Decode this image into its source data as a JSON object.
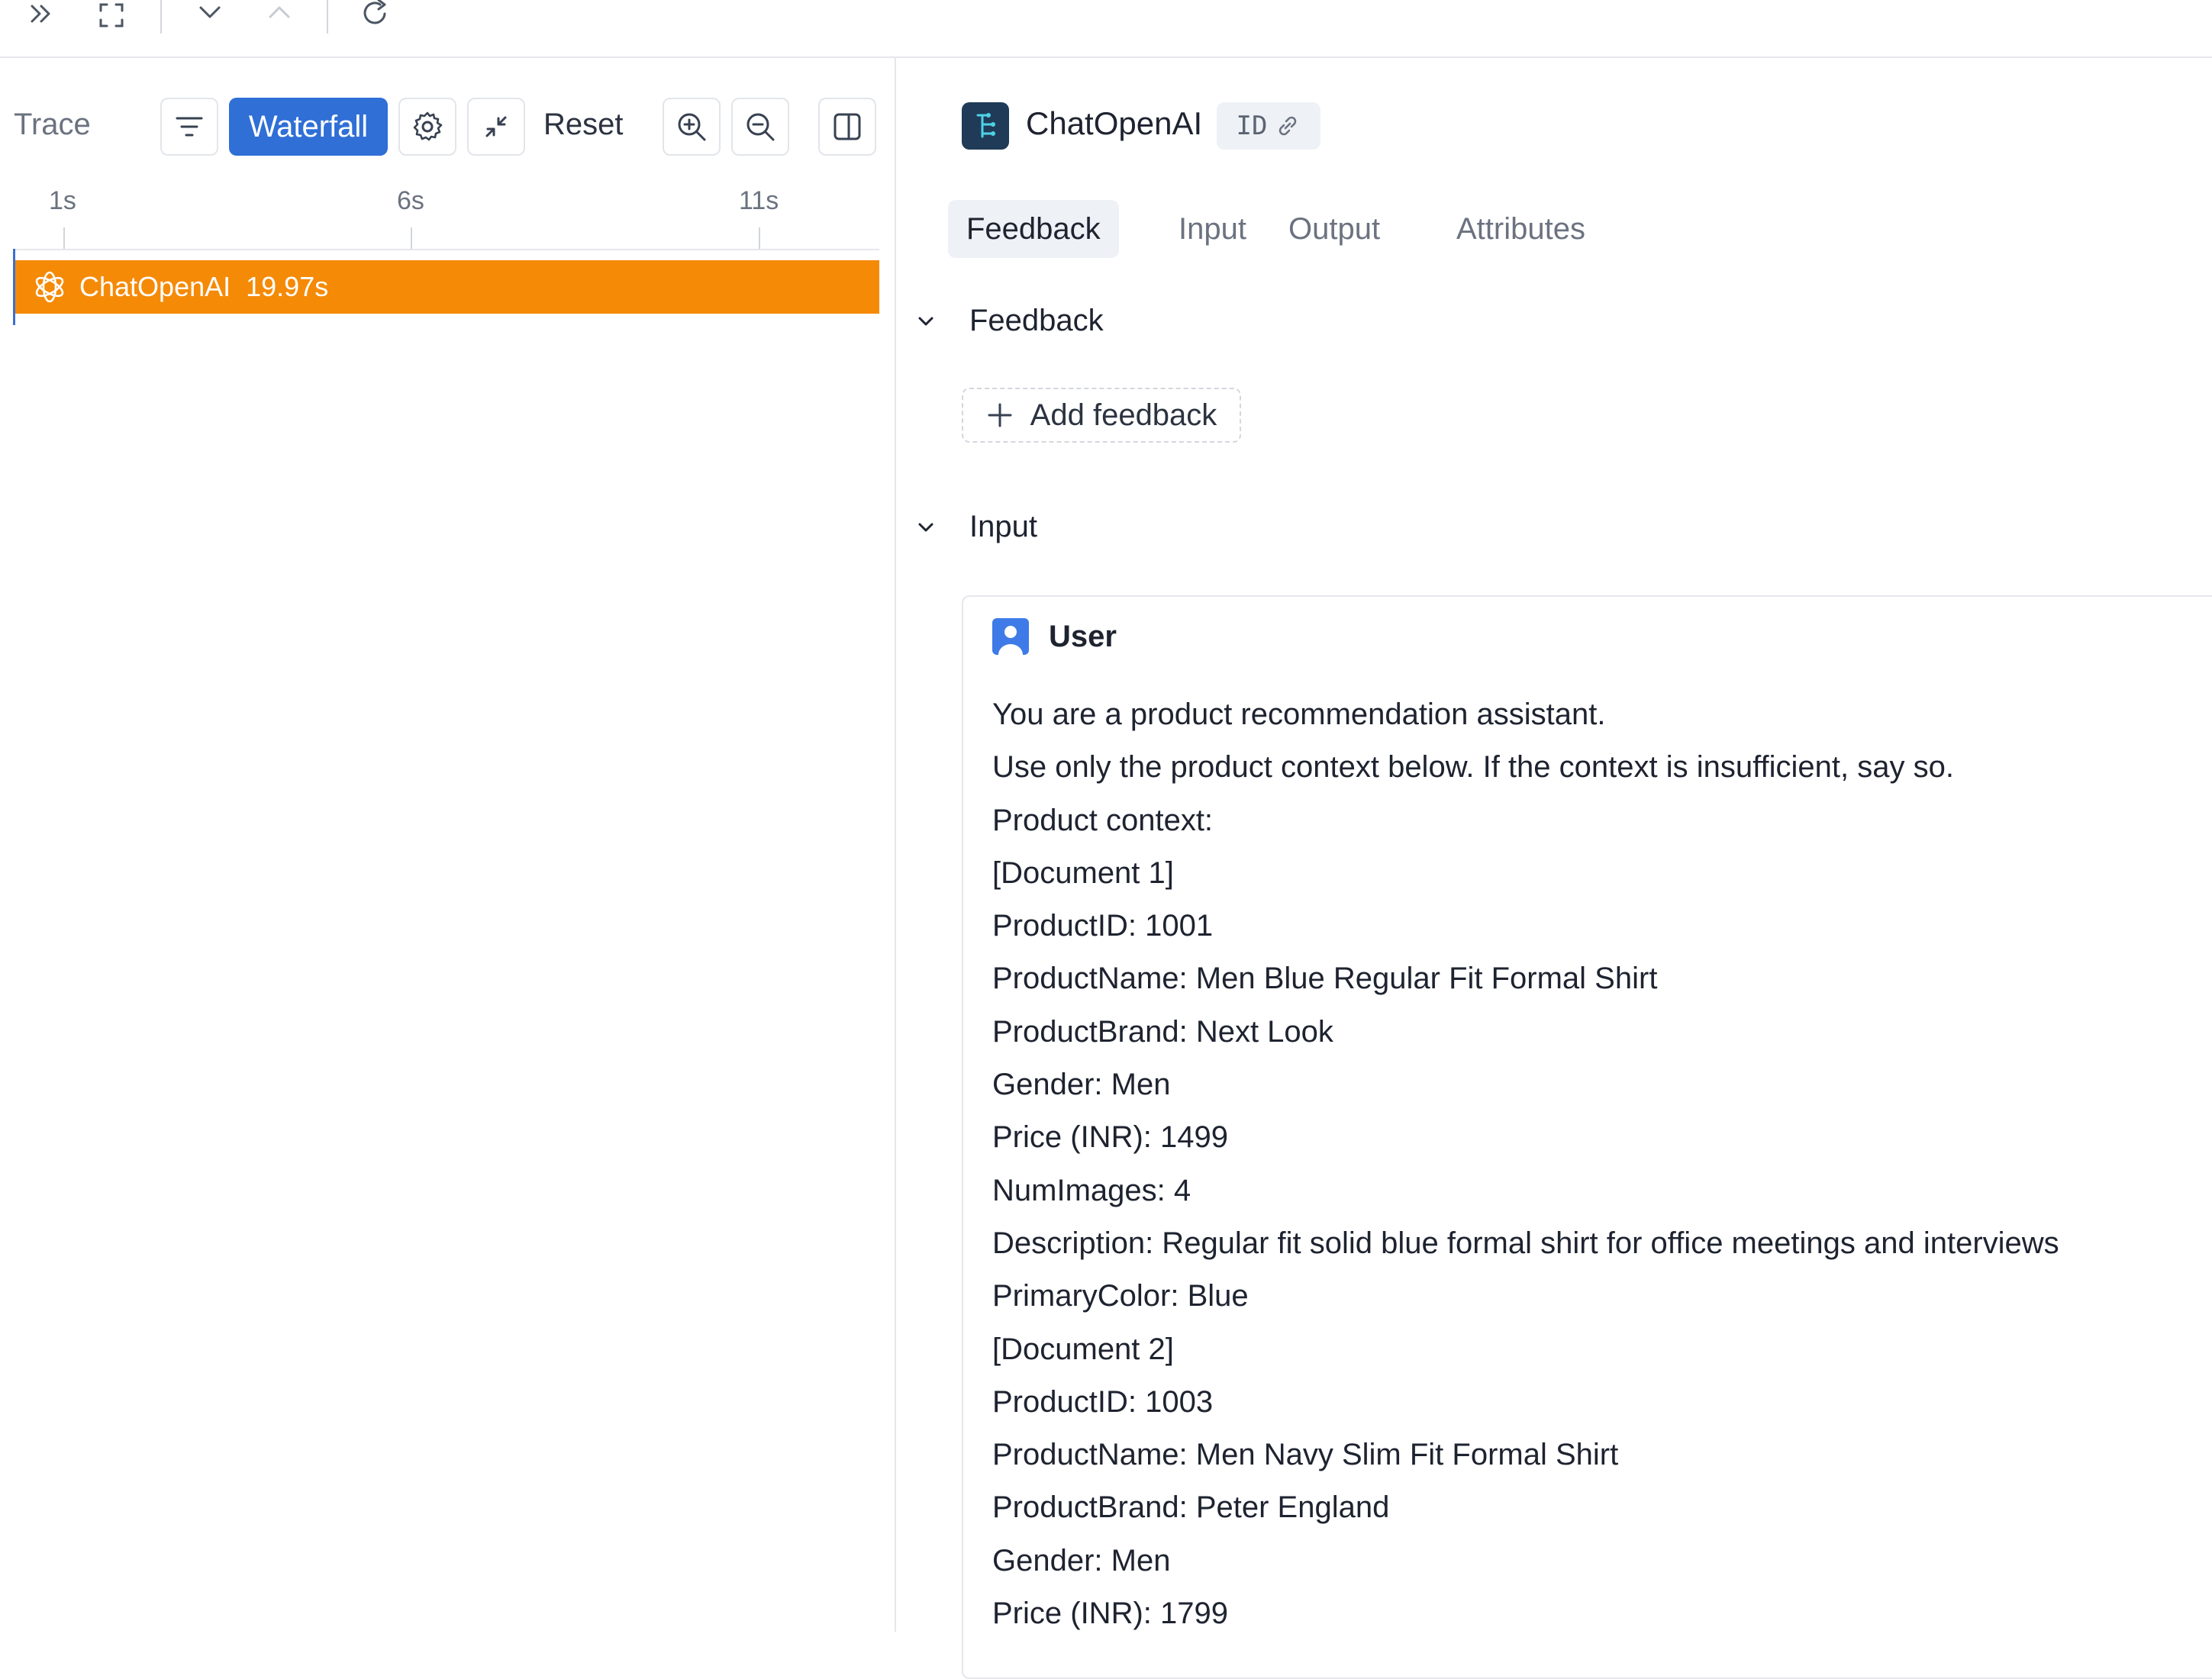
{
  "toolbar": {
    "icons": [
      "expand-double-chevron-icon",
      "fullscreen-icon",
      "chevron-down-icon",
      "chevron-up-icon",
      "refresh-icon"
    ]
  },
  "trace_panel": {
    "title": "Trace",
    "view_button_label": "Waterfall",
    "reset_label": "Reset",
    "ticks": [
      "1s",
      "6s",
      "11s"
    ],
    "span": {
      "name": "ChatOpenAI",
      "duration": "19.97s",
      "color": "#f58a07"
    }
  },
  "detail": {
    "title": "ChatOpenAI",
    "id_chip": "ID",
    "tabs": [
      "Feedback",
      "Input",
      "Output",
      "Attributes"
    ],
    "active_tab": "Feedback",
    "feedback_section": {
      "title": "Feedback",
      "add_label": "Add feedback"
    },
    "input_section": {
      "title": "Input",
      "role": "User",
      "lines": [
        "You are a product recommendation assistant.",
        "Use only the product context below. If the context is insufficient, say so.",
        "Product context:",
        "[Document 1]",
        "ProductID: 1001",
        "ProductName: Men Blue Regular Fit Formal Shirt",
        "ProductBrand: Next Look",
        "Gender: Men",
        "Price (INR): 1499",
        "NumImages: 4",
        "Description: Regular fit solid blue formal shirt for office meetings and interviews",
        "PrimaryColor: Blue",
        "[Document 2]",
        "ProductID: 1003",
        "ProductName: Men Navy Slim Fit Formal Shirt",
        "ProductBrand: Peter England",
        "Gender: Men",
        "Price (INR): 1799"
      ]
    }
  },
  "colors": {
    "accent": "#2f6fd6",
    "span": "#f58a07",
    "user_icon": "#3f7be8",
    "logo_bg": "#1f3b57"
  }
}
